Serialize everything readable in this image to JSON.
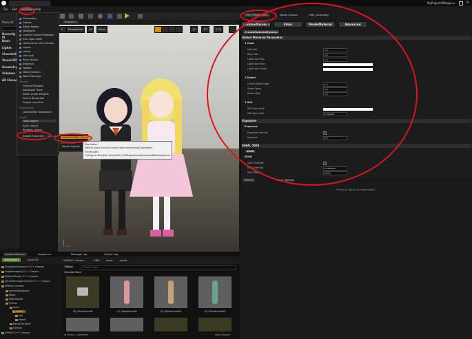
{
  "window": {
    "project_name": "MyProject426cpp",
    "tab_title": "VRMMaterial"
  },
  "menubar": {
    "items": [
      "File",
      "Edit",
      "Window",
      "Help"
    ]
  },
  "left_panel": {
    "place_actors": "Place Ac",
    "recently_placed": "Recently Pl",
    "items": [
      "Basic",
      "Lights",
      "Cinematic",
      "Visual Effe",
      "Geometry",
      "Volumes",
      "All Classes"
    ]
  },
  "window_menu": {
    "items": [
      "Cinematics",
      "Details",
      "Editor Modes",
      "Viewports",
      "Camera Shake Previewer",
      "Env. Light Mixer",
      "Hierarchical LOD Outliner",
      "Layers",
      "Levels",
      "Live Link",
      "Place Actors",
      "Statistics",
      "Toolbar",
      "World Outliner",
      "World Settings"
    ],
    "general_header": "General",
    "general_items": [
      "Content Browser",
      "Developer Tools",
      "Editor Utility Widgets",
      "Find in Blueprints",
      "Project Launcher"
    ],
    "experimental_header": "Experimental",
    "experimental_items": [
      "Localization Dashboard"
    ],
    "layout_header": "Layout",
    "layout_items": [
      "Load Layout",
      "Save Layout",
      "Remove Layout"
    ],
    "enable_fullscreen": "Enable Fullscreen",
    "fullscreen_shortcut": "Shift+F11"
  },
  "submenu": {
    "default_layout": "Default Editor Layout",
    "user_layouts_header": "User Layouts",
    "import_layout": "Import Layout..."
  },
  "tooltip": {
    "line1": "Description:",
    "line2": "Default layout that the Unreal Editor automatically generates.",
    "line3": "Full file path:",
    "line4": "C:/Program Files/Epic Games/UE_4.26/Engine/Config/Layouts/DefaultLayout.ini"
  },
  "viewport": {
    "tab": "Viewport 1",
    "perspective_btn": "Perspective",
    "lit_btn": "Lit",
    "show_btn": "Show",
    "grid_value": "10",
    "angle_value": "10°",
    "scale_value": "0.25"
  },
  "details_tabs": [
    "VRM_VRMMaterial",
    "World Outliner",
    "VRM_ControlRig"
  ],
  "param_buttons": [
    "> GlobalParam <",
    "Filter",
    "ModelMaterial",
    "Advanced"
  ],
  "create_button": "CreateMaterialSystem",
  "global_section": "Global Material Parameter",
  "color_section": {
    "title": "1 Color",
    "props": [
      "Saturate",
      "Base Pow",
      "Light Color Pow",
      "Light Color Main",
      "Light Color Shade"
    ],
    "values": [
      "1.0",
      "1.0",
      "1.0"
    ]
  },
  "model_section": {
    "title": "2 Model",
    "props": [
      "Outline Width Scale",
      "Shade Toony",
      "Shade Shift"
    ],
    "values": [
      "1.0",
      "0.0",
      "0.0"
    ]
  },
  "sss_section": {
    "title": "3 SSS",
    "props": [
      "SSS Color Scale",
      "SSS Alpha Shift"
    ],
    "values": [
      "",
      "0.000000"
    ]
  },
  "exposure_section": {
    "title": "Exposure",
    "sub": "Exposure",
    "props": [
      "Exposure Override",
      "Exposure"
    ],
    "values": [
      "",
      "0.0"
    ]
  },
  "ssao_section": {
    "title": "SSAO, SSGI",
    "button": "SSAO",
    "sub": "SSAO",
    "props": [
      "SSAO Override",
      "SSAO Intensity",
      "SSAO Radius"
    ],
    "values": [
      "",
      "0.5000000",
      "100.0"
    ]
  },
  "lower_panel": {
    "tabs": [
      "Details",
      "World Settings"
    ],
    "message": "Select an object to view details."
  },
  "content_browser": {
    "tabs": [
      "Content Browser",
      "Sequencer",
      "Message Log",
      "Output Log"
    ],
    "add_import": "Add/Import",
    "save_all": "Save All",
    "path": [
      "VRM4U Content",
      "VRM",
      "Actor",
      "latest"
    ],
    "filters": "Filters",
    "search_placeholder": "Search latest",
    "category": "Skeletal Mesh",
    "tree": [
      "TemplateSequence C++ Classes",
      "UdpMessaging C++ Classes",
      "UObjectPlugin C++ Classes",
      "VariantManagerContent C++ Classes",
      "VRM4U Content",
      "ImportDataAsset",
      "Maps",
      "MaterialUtil",
      "Python",
      "Actor",
      "latest",
      "sub",
      "Mixed",
      "BaseCharacter",
      "System",
      "VRM4U C++ Classes"
    ],
    "assets": [
      "CR_VRoidSimpleM",
      "CR_VRoidSimpleW",
      "CR_VRoidSimpleW1",
      "CR_VRoidSimpleW2"
    ],
    "items_count": "16 items (1 selected)",
    "view_options": "View Options"
  },
  "colors": {
    "annotation": "#e0141c",
    "accent": "#d09000",
    "panel": "#1c1c1c"
  }
}
